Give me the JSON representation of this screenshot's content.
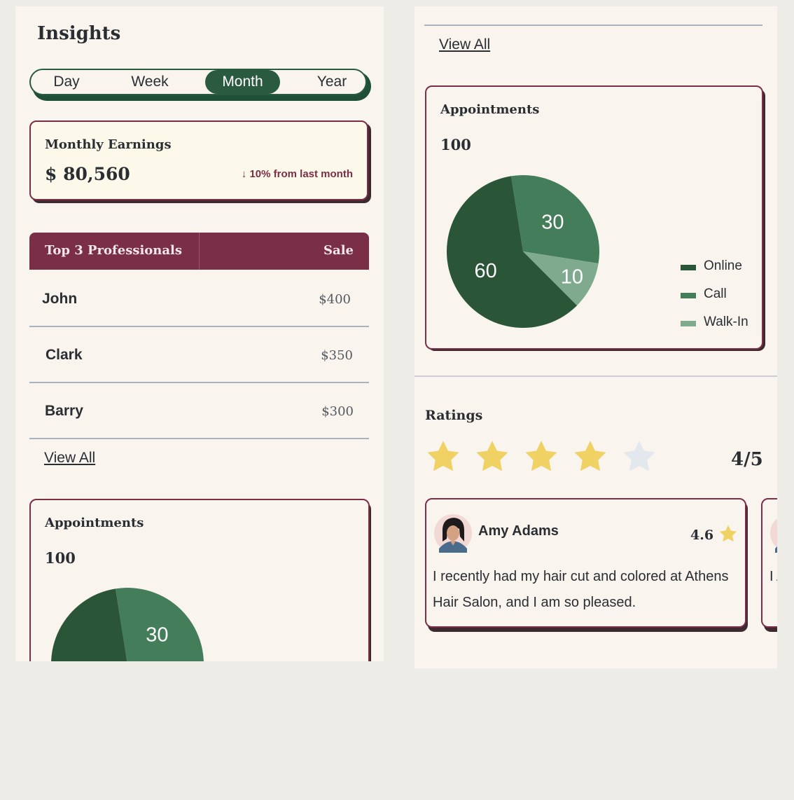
{
  "app": {
    "title": "Insights",
    "tabs": [
      "Day",
      "Week",
      "Month",
      "Year"
    ],
    "active_tab": "Month"
  },
  "earnings": {
    "label": "Monthly Earnings",
    "amount": "$ 80,560",
    "change": "↓ 10% from last month"
  },
  "professionals": {
    "header_name": "Top 3 Professionals",
    "header_sale": "Sale",
    "rows": [
      {
        "name": "John",
        "sale": "$400"
      },
      {
        "name": "Clark",
        "sale": "$350"
      },
      {
        "name": "Barry",
        "sale": "$300"
      }
    ],
    "view_all": "View All"
  },
  "appointments": {
    "title": "Appointments",
    "total": "100",
    "view_all": "View All",
    "chart_data": {
      "type": "pie",
      "title": "Appointments",
      "categories": [
        "Online",
        "Call",
        "Walk-In"
      ],
      "values": [
        60,
        30,
        10
      ],
      "colors": [
        "#2A5537",
        "#447D59",
        "#7FAA8D"
      ],
      "legend": "right"
    }
  },
  "ratings": {
    "title": "Ratings",
    "score": "4/5",
    "stars_filled": 4,
    "stars_total": 5,
    "star_color": "#F0D264",
    "empty_star_color": "#E3E7EE"
  },
  "reviews": [
    {
      "name": "Amy Adams",
      "rating": "4.6",
      "text": "I recently had my hair cut and colored at Athens Hair Salon, and I am so pleased."
    },
    {
      "name": "",
      "rating": "",
      "text": "I A"
    }
  ],
  "nav": {
    "items": [
      {
        "icon": "calendar-icon"
      },
      {
        "icon": "pie-chart-icon"
      },
      {
        "icon": "more-icon"
      }
    ],
    "active": "pie-chart-icon"
  },
  "colors": {
    "accent": "#7A2E48",
    "green": "#2A5A40",
    "nav_bg": "#1B1F22",
    "nav_active": "#F0D264"
  }
}
